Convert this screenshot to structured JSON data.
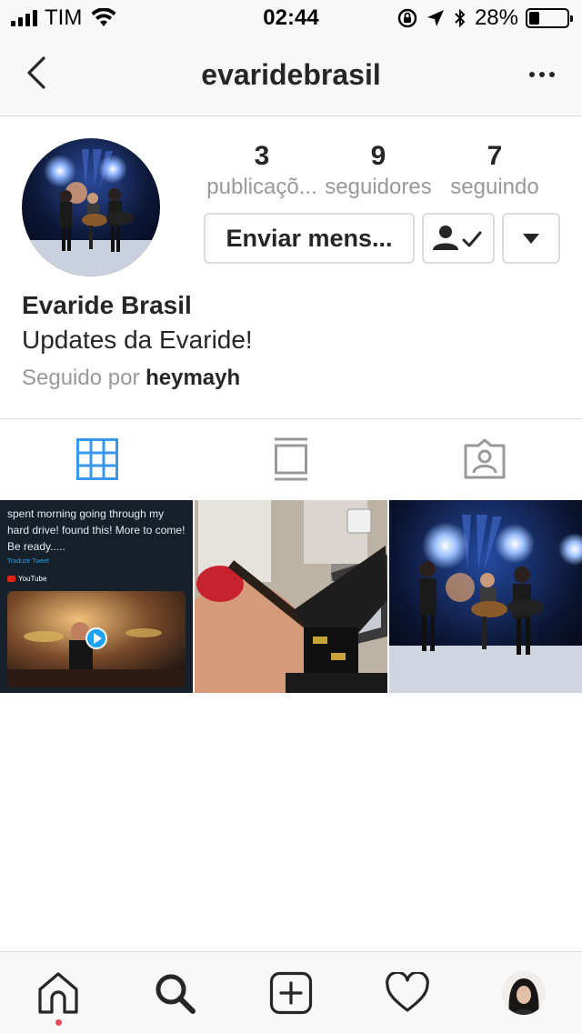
{
  "status_bar": {
    "carrier": "TIM",
    "time": "02:44",
    "battery_percent": "28%",
    "battery_level": 0.28,
    "icons": [
      "signal-icon",
      "wifi-icon",
      "rotation-lock-icon",
      "location-arrow-icon",
      "bluetooth-icon",
      "battery-icon"
    ]
  },
  "header": {
    "username": "evaridebrasil",
    "back_icon": "chevron-left-icon",
    "more_icon": "more-dots-icon"
  },
  "profile": {
    "stats": [
      {
        "value": "3",
        "label": "publicaçõ..."
      },
      {
        "value": "9",
        "label": "seguidores"
      },
      {
        "value": "7",
        "label": "seguindo"
      }
    ],
    "message_button": "Enviar mens...",
    "full_name": "Evaride Brasil",
    "bio": "Updates da Evaride!",
    "followed_by_prefix": "Seguido por",
    "followed_by_user": "heymayh"
  },
  "tabs": [
    {
      "icon": "grid-icon",
      "active": true
    },
    {
      "icon": "feed-list-icon",
      "active": false
    },
    {
      "icon": "tagged-photos-icon",
      "active": false
    }
  ],
  "posts": [
    {
      "kind": "tweet-screenshot",
      "tweet_text": "spent morning going through my hard drive! found this!  More to come! Be ready.....",
      "translate": "Traduzir Tweet",
      "source": "YouTube"
    },
    {
      "kind": "photo"
    },
    {
      "kind": "photo"
    }
  ],
  "bottom_nav": [
    "home-icon",
    "search-icon",
    "new-post-icon",
    "activity-heart-icon",
    "profile-avatar"
  ],
  "colors": {
    "accent": "#3897f0",
    "text": "#262626",
    "secondary": "#999999",
    "notification": "#ed4956"
  }
}
